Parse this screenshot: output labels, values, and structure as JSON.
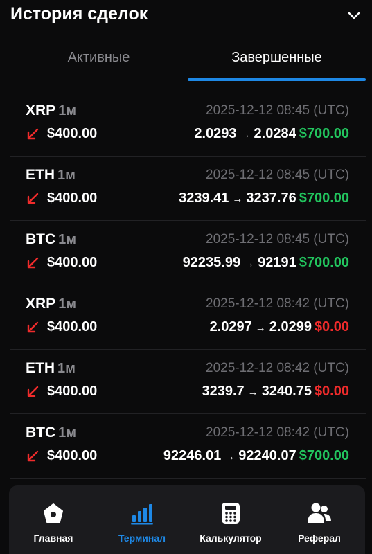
{
  "header": {
    "title": "История сделок"
  },
  "tabs": [
    {
      "label": "Активные",
      "active": false
    },
    {
      "label": "Завершенные",
      "active": true
    }
  ],
  "trades": [
    {
      "symbol": "XRP",
      "timeframe": "1м",
      "date": "2025-12-12 08:45 (UTC)",
      "amount": "$400.00",
      "open": "2.0293",
      "close": "2.0284",
      "profit": "$700.00",
      "result": "win"
    },
    {
      "symbol": "ETH",
      "timeframe": "1м",
      "date": "2025-12-12 08:45 (UTC)",
      "amount": "$400.00",
      "open": "3239.41",
      "close": "3237.76",
      "profit": "$700.00",
      "result": "win"
    },
    {
      "symbol": "BTC",
      "timeframe": "1м",
      "date": "2025-12-12 08:45 (UTC)",
      "amount": "$400.00",
      "open": "92235.99",
      "close": "92191",
      "profit": "$700.00",
      "result": "win"
    },
    {
      "symbol": "XRP",
      "timeframe": "1м",
      "date": "2025-12-12 08:42 (UTC)",
      "amount": "$400.00",
      "open": "2.0297",
      "close": "2.0299",
      "profit": "$0.00",
      "result": "loss"
    },
    {
      "symbol": "ETH",
      "timeframe": "1м",
      "date": "2025-12-12 08:42 (UTC)",
      "amount": "$400.00",
      "open": "3239.7",
      "close": "3240.75",
      "profit": "$0.00",
      "result": "loss"
    },
    {
      "symbol": "BTC",
      "timeframe": "1м",
      "date": "2025-12-12 08:42 (UTC)",
      "amount": "$400.00",
      "open": "92246.01",
      "close": "92240.07",
      "profit": "$700.00",
      "result": "win"
    }
  ],
  "arrow_glyph": "→",
  "direction_icon": "arrow-down-left-icon",
  "nav": [
    {
      "label": "Главная",
      "icon": "home-icon",
      "active": false
    },
    {
      "label": "Терминал",
      "icon": "bar-chart-icon",
      "active": true
    },
    {
      "label": "Калькулятор",
      "icon": "calculator-icon",
      "active": false
    },
    {
      "label": "Реферал",
      "icon": "users-icon",
      "active": false
    }
  ],
  "colors": {
    "accent": "#1e88e5",
    "win": "#22c55e",
    "loss": "#ef2b2b",
    "direction_down": "#ef2b2b"
  }
}
